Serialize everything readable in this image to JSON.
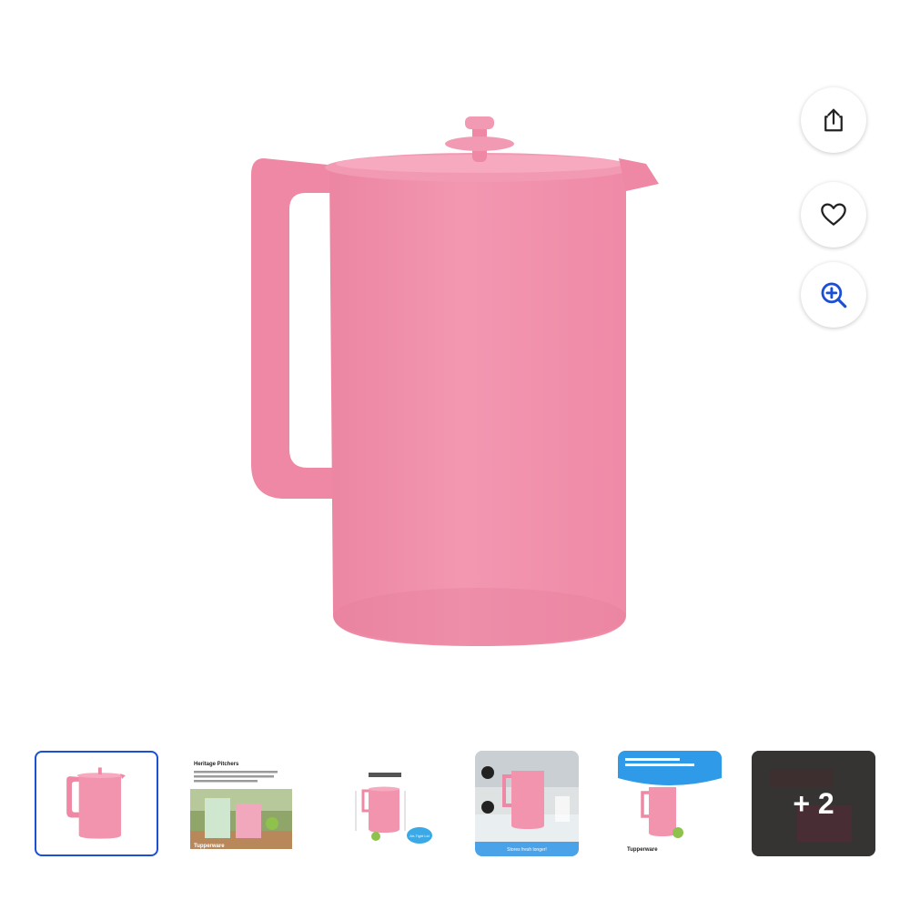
{
  "colors": {
    "accent": "#1a4fd6",
    "pitcher_pink": "#f08fab",
    "overlay": "#333333"
  },
  "main_image": {
    "icon": "pink-pitcher-product-image"
  },
  "side_actions": [
    {
      "icon": "share-icon"
    },
    {
      "icon": "heart-icon"
    },
    {
      "icon": "zoom-in-icon"
    }
  ],
  "thumbnails": {
    "selected_index": 0,
    "items": [
      {
        "kind": "product"
      },
      {
        "kind": "lifestyle",
        "title": "Heritage Pitchers",
        "brand": "Tupperware"
      },
      {
        "kind": "dimensions",
        "badge": "Air-Tight Lid"
      },
      {
        "kind": "kitchen",
        "caption": "Stores fresh longer!"
      },
      {
        "kind": "promo",
        "brand": "Tupperware"
      },
      {
        "kind": "more",
        "more_label": "+ 2"
      }
    ]
  }
}
